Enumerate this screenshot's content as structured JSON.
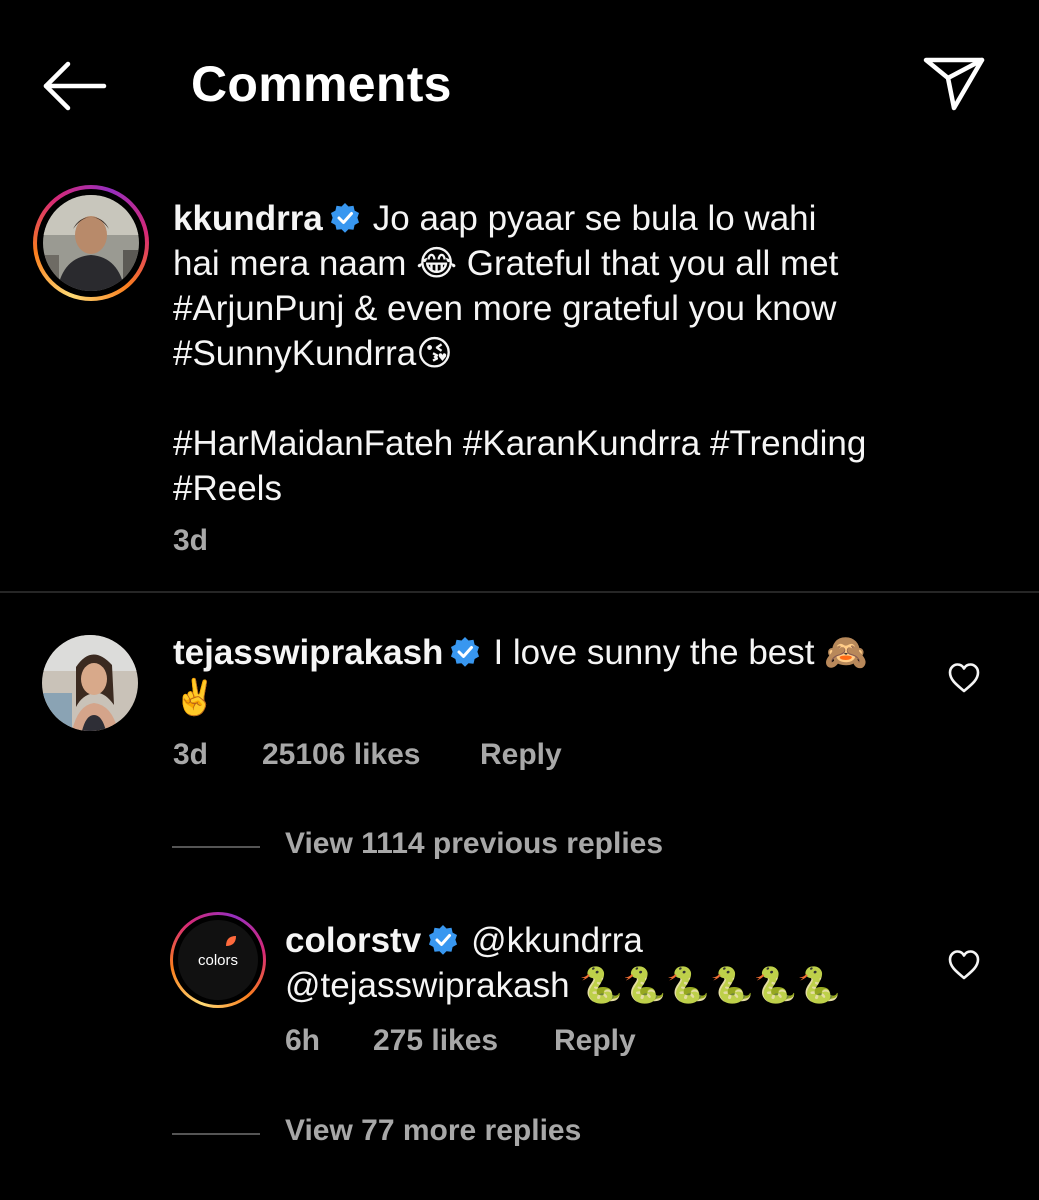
{
  "header": {
    "title": "Comments",
    "back_icon": "arrow-left-icon",
    "share_icon": "paper-plane-icon"
  },
  "caption": {
    "username": "kkundrra",
    "lines": [
      "Jo aap pyaar se bula lo wahi",
      "hai mera naam 😂 Grateful that you all met",
      "#ArjunPunj & even more grateful you know",
      "#SunnyKundrra😘"
    ],
    "tags_lines": [
      "#HarMaidanFateh #KaranKundrra #Trending",
      "#Reels"
    ],
    "time": "3d"
  },
  "comment": {
    "username": "tejasswiprakash",
    "text_line1": "I love sunny the best 🙈",
    "text_line2": "✌️",
    "time": "3d",
    "likes": "25106 likes",
    "reply_label": "Reply",
    "view_previous": "View 1114 previous replies"
  },
  "reply": {
    "username": "colorstv",
    "avatar_text": "colors",
    "text_line1": "@kkundrra",
    "text_line2": "@tejasswiprakash 🐍🐍🐍🐍🐍🐍",
    "time": "6h",
    "likes": "275 likes",
    "reply_label": "Reply",
    "view_more": "View 77 more replies"
  },
  "colors": {
    "background": "#000000",
    "text": "#f5f5f5",
    "secondary": "#a8a8a8",
    "verified": "#3897f0"
  }
}
